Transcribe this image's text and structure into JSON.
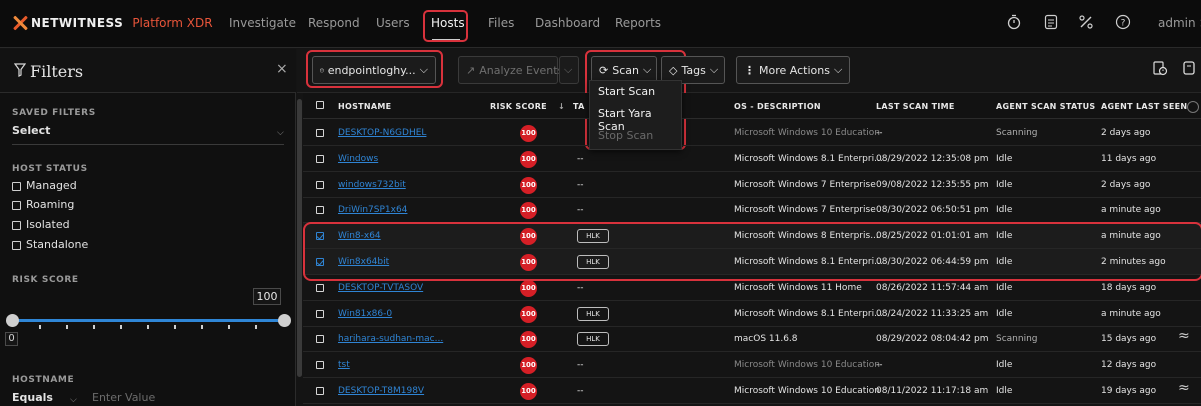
{
  "nav": {
    "brand": "NETWITNESS",
    "brand_sub": "Platform XDR",
    "links": [
      "Investigate",
      "Respond",
      "Users",
      "Hosts",
      "Files",
      "Dashboard",
      "Reports"
    ],
    "active": "Hosts",
    "user": "admin",
    "user_chevron": ">",
    "icons": [
      "timer-icon",
      "calculator-icon",
      "tools-icon",
      "help-icon"
    ]
  },
  "filters": {
    "title": "Filters",
    "close": "×",
    "saved_filters_label": "SAVED FILTERS",
    "saved_filter_value": "Select",
    "host_status_label": "HOST STATUS",
    "host_status_options": [
      "Managed",
      "Roaming",
      "Isolated",
      "Standalone"
    ],
    "risk_score_label": "RISK SCORE",
    "risk_score_max": "100",
    "risk_score_min": "0",
    "risk_score_range": [
      0,
      100
    ],
    "hostname_label": "HOSTNAME",
    "hostname_operator": "Equals",
    "hostname_placeholder": "Enter Value"
  },
  "toolbar": {
    "source_select": "endpointloghy...",
    "analyze_events": "Analyze Events",
    "scan": "Scan",
    "tags": "Tags",
    "more_actions": "More Actions"
  },
  "scan_menu": {
    "items": [
      "Start Scan",
      "Start Yara Scan",
      "Stop Scan"
    ],
    "disabled": [
      "Stop Scan"
    ]
  },
  "table": {
    "columns": [
      "HOSTNAME",
      "RISK SCORE",
      "TA",
      "OS - DESCRIPTION",
      "LAST SCAN TIME",
      "AGENT SCAN STATUS",
      "AGENT LAST SEEN"
    ],
    "sort_indicator": "↓",
    "rows": [
      {
        "hostname": "DESKTOP-N6GDHEL",
        "risk": "100",
        "tag": "",
        "os": "Microsoft Windows 10 Education",
        "last_scan": "--",
        "status": "Scanning",
        "last_seen": "2 days ago",
        "selected": false
      },
      {
        "hostname": "Windows",
        "risk": "100",
        "tag": "--",
        "os": "Microsoft Windows 8.1 Enterpri...",
        "last_scan": "08/29/2022 12:35:08 pm",
        "status": "Idle",
        "last_seen": "11 days ago",
        "selected": false
      },
      {
        "hostname": "windows732bit",
        "risk": "100",
        "tag": "--",
        "os": "Microsoft Windows 7 Enterprise",
        "last_scan": "09/08/2022 12:35:55 pm",
        "status": "Idle",
        "last_seen": "2 days ago",
        "selected": false
      },
      {
        "hostname": "DriWin7SP1x64",
        "risk": "100",
        "tag": "--",
        "os": "Microsoft Windows 7 Enterprise",
        "last_scan": "08/30/2022 06:50:51 pm",
        "status": "Idle",
        "last_seen": "a minute ago",
        "selected": false
      },
      {
        "hostname": "Win8-x64",
        "risk": "100",
        "tag": "HLK",
        "os": "Microsoft Windows 8 Enterpris...",
        "last_scan": "08/25/2022 01:01:01 am",
        "status": "Idle",
        "last_seen": "a minute ago",
        "selected": true
      },
      {
        "hostname": "Win8x64bit",
        "risk": "100",
        "tag": "HLK",
        "os": "Microsoft Windows 8.1 Enterpri...",
        "last_scan": "08/30/2022 06:44:59 pm",
        "status": "Idle",
        "last_seen": "2 minutes ago",
        "selected": true
      },
      {
        "hostname": "DESKTOP-TVTASOV",
        "risk": "100",
        "tag": "--",
        "os": "Microsoft Windows 11 Home",
        "last_scan": "08/26/2022 11:57:44 am",
        "status": "Idle",
        "last_seen": "18 days ago",
        "selected": false
      },
      {
        "hostname": "Win81x86-0",
        "risk": "100",
        "tag": "HLK",
        "os": "Microsoft Windows 8.1 Enterpri...",
        "last_scan": "08/24/2022 11:33:25 am",
        "status": "Idle",
        "last_seen": "a minute ago",
        "selected": false
      },
      {
        "hostname": "harihara-sudhan-mac...",
        "risk": "100",
        "tag": "HLK",
        "os": "macOS 11.6.8",
        "last_scan": "08/29/2022 08:04:42 pm",
        "status": "Scanning",
        "last_seen": "15 days ago",
        "selected": false
      },
      {
        "hostname": "tst",
        "risk": "100",
        "tag": "--",
        "os": "Microsoft Windows 10 Education",
        "last_scan": "--",
        "status": "Idle",
        "last_seen": "12 days ago",
        "selected": false
      },
      {
        "hostname": "DESKTOP-T8M198V",
        "risk": "100",
        "tag": "--",
        "os": "Microsoft Windows 10 Education",
        "last_scan": "08/11/2022 11:17:18 am",
        "status": "Idle",
        "last_seen": "19 days ago",
        "selected": false
      }
    ]
  },
  "colors": {
    "accent": "#2f84d4",
    "risk": "#d51f26",
    "highlight": "#d8323c",
    "brand": "#e8553a"
  }
}
